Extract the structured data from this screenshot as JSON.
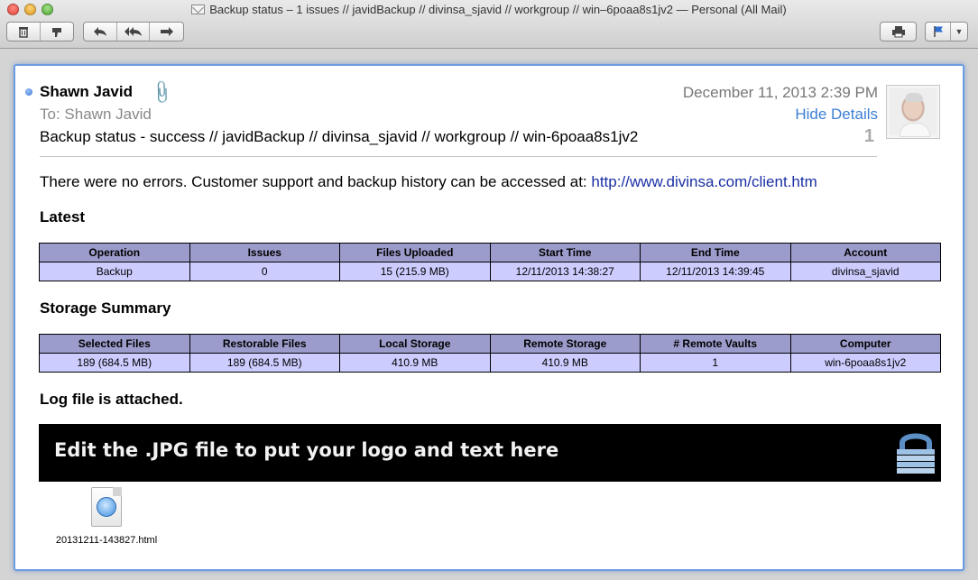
{
  "window": {
    "title": "Backup status – 1 issues // javidBackup // divinsa_sjavid // workgroup // win–6poaa8s1jv2 — Personal (All Mail)"
  },
  "toolbar": {
    "icons": [
      "trash-icon",
      "junk-icon",
      "reply-icon",
      "reply-all-icon",
      "forward-icon",
      "print-icon",
      "flag-icon"
    ]
  },
  "message": {
    "sender": "Shawn Javid",
    "to_label": "To:",
    "to_name": "Shawn Javid",
    "subject": "Backup status - success // javidBackup // divinsa_sjavid // workgroup // win-6poaa8s1jv2",
    "date": "December 11, 2013  2:39 PM",
    "hide_details": "Hide Details",
    "count": "1",
    "body_text": "There were no errors. Customer support and backup history can be accessed at: ",
    "body_link": "http://www.divinsa.com/client.htm"
  },
  "latest": {
    "title": "Latest",
    "headers": [
      "Operation",
      "Issues",
      "Files Uploaded",
      "Start Time",
      "End Time",
      "Account"
    ],
    "row": [
      "Backup",
      "0",
      "15 (215.9 MB)",
      "12/11/2013 14:38:27",
      "12/11/2013 14:39:45",
      "divinsa_sjavid"
    ]
  },
  "storage": {
    "title": "Storage Summary",
    "headers": [
      "Selected Files",
      "Restorable Files",
      "Local Storage",
      "Remote Storage",
      "# Remote Vaults",
      "Computer"
    ],
    "row": [
      "189 (684.5 MB)",
      "189 (684.5 MB)",
      "410.9 MB",
      "410.9 MB",
      "1",
      "win-6poaa8s1jv2"
    ]
  },
  "log": {
    "title": "Log file is attached."
  },
  "banner": {
    "text": "Edit the .JPG file to put your logo and text here"
  },
  "attachment": {
    "filename": "20131211-143827.html"
  },
  "colors": {
    "header_bg": "#9c9ccc",
    "cell_bg": "#ccccff",
    "link": "#1a2fa3",
    "accent": "#3d7fd6"
  }
}
